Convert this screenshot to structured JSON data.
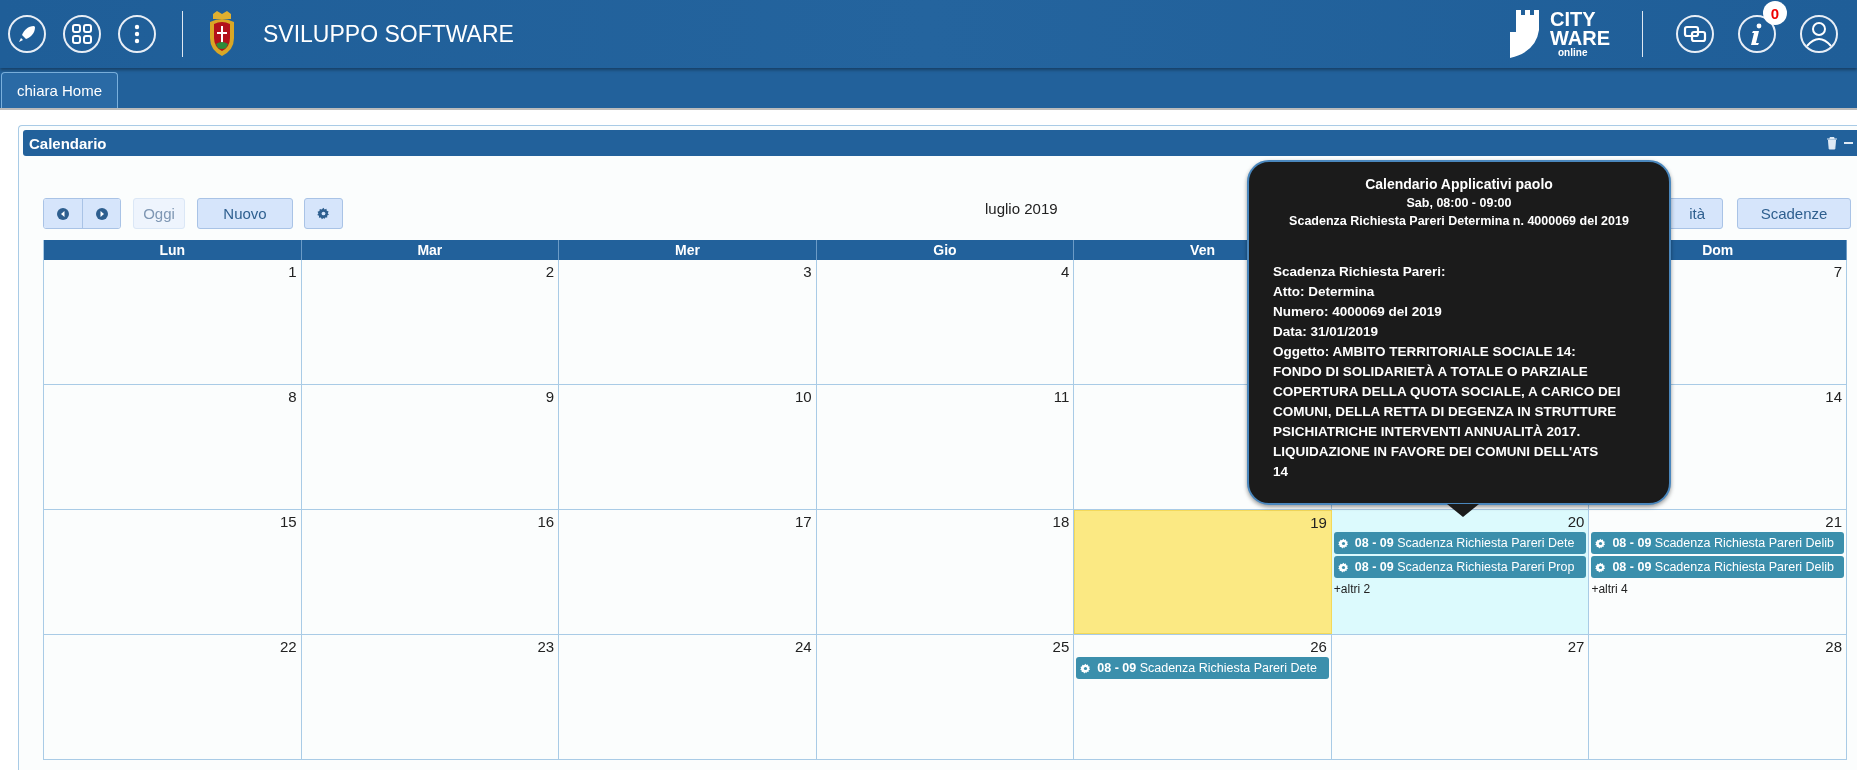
{
  "header": {
    "title": "SVILUPPO SOFTWARE",
    "brand": [
      "CITY",
      "WARE",
      "online"
    ],
    "notifications": "0"
  },
  "tabs": [
    {
      "label": "chiara Home",
      "selected": true
    }
  ],
  "panel": {
    "title": "Calendario"
  },
  "toolbar": {
    "today": {
      "label": "Oggi",
      "disabled": true
    },
    "new": "Nuovo",
    "period": "luglio 2019",
    "views": [
      {
        "label": "ità"
      },
      {
        "label": "Scadenze"
      }
    ]
  },
  "weekdays": {
    "leading": [
      "Lun",
      "Mar",
      "Mer",
      "Gio",
      "Ven"
    ],
    "trailing": [
      "Dom"
    ]
  },
  "weeks": [
    {
      "days": [
        {
          "number": "1"
        },
        {
          "number": "2"
        },
        {
          "number": "3"
        },
        {
          "number": "4"
        }
      ],
      "trailing": [
        {
          "number": "7"
        }
      ]
    },
    {
      "days": [
        {
          "number": "8"
        },
        {
          "number": "9"
        },
        {
          "number": "10"
        },
        {
          "number": "11"
        }
      ],
      "trailing": [
        {
          "number": "14"
        }
      ]
    },
    {
      "days": [
        {
          "number": "15"
        },
        {
          "number": "16"
        },
        {
          "number": "17"
        },
        {
          "number": "18"
        },
        {
          "number": "19",
          "today": true
        },
        {
          "number": "20",
          "selected": true,
          "events": [
            {
              "time": "08 - 09",
              "text": "Scadenza Richiesta Pareri Dete"
            },
            {
              "time": "08 - 09",
              "text": "Scadenza Richiesta Pareri Prop"
            }
          ],
          "more": "+altri 2"
        },
        {
          "number": "21",
          "events": [
            {
              "time": "08 - 09",
              "text": "Scadenza Richiesta Pareri Delib"
            },
            {
              "time": "08 - 09",
              "text": "Scadenza Richiesta Pareri Delib"
            }
          ],
          "more": "+altri 4"
        }
      ]
    },
    {
      "days": [
        {
          "number": "22"
        },
        {
          "number": "23"
        },
        {
          "number": "24"
        },
        {
          "number": "25"
        },
        {
          "number": "26",
          "events": [
            {
              "time": "08 - 09",
              "text": "Scadenza Richiesta Pareri Dete"
            }
          ]
        },
        {
          "number": "27"
        },
        {
          "number": "28"
        }
      ]
    }
  ],
  "tooltip": {
    "title": "Calendario Applicativi paolo",
    "time": "Sab, 08:00 - 09:00",
    "subject": "Scadenza Richiesta Pareri Determina n. 4000069 del 2019",
    "lines": [
      "Scadenza Richiesta Pareri:",
      "Atto: Determina",
      "Numero: 4000069 del 2019",
      "Data: 31/01/2019",
      "Oggetto: AMBITO TERRITORIALE SOCIALE 14:",
      "FONDO DI SOLIDARIETÀ A TOTALE O PARZIALE",
      "COPERTURA DELLA QUOTA SOCIALE, A CARICO DEI",
      "COMUNI, DELLA RETTA DI DEGENZA IN STRUTTURE",
      "PSICHIATRICHE INTERVENTI ANNUALITÀ 2017.",
      "LIQUIDAZIONE IN FAVORE DEI COMUNI DELL'ATS",
      "14"
    ]
  }
}
